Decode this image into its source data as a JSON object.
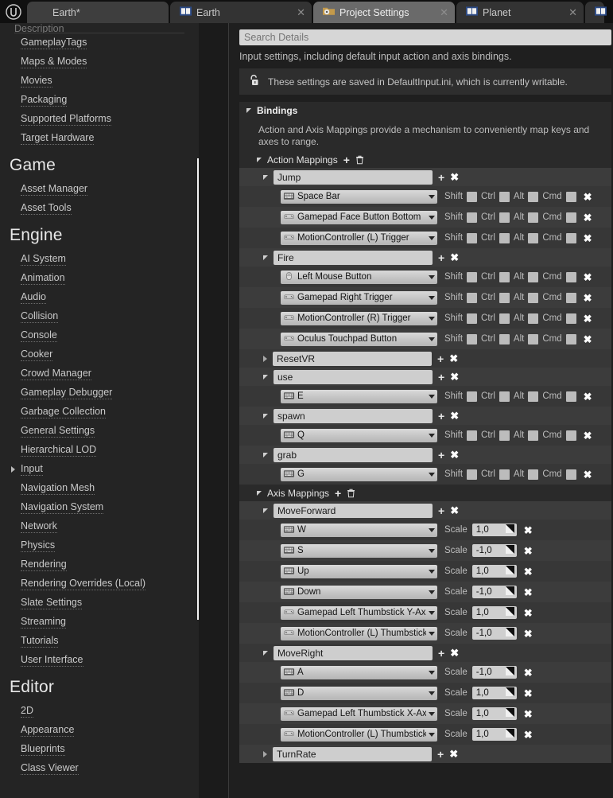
{
  "app": {
    "logo": "unreal-logo"
  },
  "tabs": [
    {
      "label": "Earth*",
      "icon": "",
      "closable": false,
      "state": "project"
    },
    {
      "label": "Earth",
      "icon": "level-icon",
      "closable": true,
      "state": "inactive"
    },
    {
      "label": "Project Settings",
      "icon": "settings-folder-icon",
      "closable": true,
      "state": "active"
    },
    {
      "label": "Planet",
      "icon": "level-icon",
      "closable": true,
      "state": "inactive"
    },
    {
      "label": "",
      "icon": "level-icon",
      "closable": false,
      "state": "inactive"
    }
  ],
  "sidebar": {
    "clipped_top_item": "Description",
    "groups": [
      {
        "heading": "",
        "items": [
          {
            "label": "GameplayTags",
            "expandable": false
          },
          {
            "label": "Maps & Modes",
            "expandable": false
          },
          {
            "label": "Movies",
            "expandable": false
          },
          {
            "label": "Packaging",
            "expandable": false
          },
          {
            "label": "Supported Platforms",
            "expandable": false
          },
          {
            "label": "Target Hardware",
            "expandable": false
          }
        ]
      },
      {
        "heading": "Game",
        "items": [
          {
            "label": "Asset Manager",
            "expandable": false
          },
          {
            "label": "Asset Tools",
            "expandable": false
          }
        ]
      },
      {
        "heading": "Engine",
        "items": [
          {
            "label": "AI System",
            "expandable": false
          },
          {
            "label": "Animation",
            "expandable": false
          },
          {
            "label": "Audio",
            "expandable": false
          },
          {
            "label": "Collision",
            "expandable": false
          },
          {
            "label": "Console",
            "expandable": false
          },
          {
            "label": "Cooker",
            "expandable": false
          },
          {
            "label": "Crowd Manager",
            "expandable": false
          },
          {
            "label": "Gameplay Debugger",
            "expandable": false
          },
          {
            "label": "Garbage Collection",
            "expandable": false
          },
          {
            "label": "General Settings",
            "expandable": false
          },
          {
            "label": "Hierarchical LOD",
            "expandable": false
          },
          {
            "label": "Input",
            "expandable": true
          },
          {
            "label": "Navigation Mesh",
            "expandable": false
          },
          {
            "label": "Navigation System",
            "expandable": false
          },
          {
            "label": "Network",
            "expandable": false
          },
          {
            "label": "Physics",
            "expandable": false
          },
          {
            "label": "Rendering",
            "expandable": false
          },
          {
            "label": "Rendering Overrides (Local)",
            "expandable": false
          },
          {
            "label": "Slate Settings",
            "expandable": false
          },
          {
            "label": "Streaming",
            "expandable": false
          },
          {
            "label": "Tutorials",
            "expandable": false
          },
          {
            "label": "User Interface",
            "expandable": false
          }
        ]
      },
      {
        "heading": "Editor",
        "items": [
          {
            "label": "2D",
            "expandable": false
          },
          {
            "label": "Appearance",
            "expandable": false
          },
          {
            "label": "Blueprints",
            "expandable": false
          },
          {
            "label": "Class Viewer",
            "expandable": false
          }
        ]
      }
    ]
  },
  "main": {
    "search_placeholder": "Search Details",
    "description": "Input settings, including default input action and axis bindings.",
    "notice": {
      "icon": "unlocked-padlock-icon",
      "text": "These settings are saved in DefaultInput.ini, which is currently writable."
    },
    "section": {
      "title": "Bindings",
      "expanded": true
    },
    "hint": "Action and Axis Mappings provide a mechanism to conveniently map keys and axes to range.",
    "action_group": {
      "label": "Action Mappings",
      "expanded": true,
      "add": "+",
      "delete": "trash-icon"
    },
    "axis_group": {
      "label": "Axis Mappings",
      "expanded": true,
      "add": "+",
      "delete": "trash-icon"
    },
    "mod_labels": {
      "shift": "Shift",
      "ctrl": "Ctrl",
      "alt": "Alt",
      "cmd": "Cmd"
    },
    "scale_label": "Scale"
  },
  "action_mappings": [
    {
      "name": "Jump",
      "expanded": true,
      "keys": [
        {
          "key": "Space Bar",
          "device": "keyboard-icon",
          "shift": false,
          "ctrl": false,
          "alt": false,
          "cmd": false
        },
        {
          "key": "Gamepad Face Button Bottom",
          "device": "gamepad-icon",
          "shift": false,
          "ctrl": false,
          "alt": false,
          "cmd": false
        },
        {
          "key": "MotionController (L) Trigger",
          "device": "gamepad-icon",
          "shift": false,
          "ctrl": false,
          "alt": false,
          "cmd": false
        }
      ]
    },
    {
      "name": "Fire",
      "expanded": true,
      "keys": [
        {
          "key": "Left Mouse Button",
          "device": "mouse-icon",
          "shift": false,
          "ctrl": false,
          "alt": false,
          "cmd": false
        },
        {
          "key": "Gamepad Right Trigger",
          "device": "gamepad-icon",
          "shift": false,
          "ctrl": false,
          "alt": false,
          "cmd": false
        },
        {
          "key": "MotionController (R) Trigger",
          "device": "gamepad-icon",
          "shift": false,
          "ctrl": false,
          "alt": false,
          "cmd": false
        },
        {
          "key": "Oculus Touchpad Button",
          "device": "gamepad-icon",
          "shift": false,
          "ctrl": false,
          "alt": false,
          "cmd": false
        }
      ]
    },
    {
      "name": "ResetVR",
      "expanded": false,
      "keys": []
    },
    {
      "name": "use",
      "expanded": true,
      "keys": [
        {
          "key": "E",
          "device": "keyboard-icon",
          "shift": false,
          "ctrl": false,
          "alt": false,
          "cmd": false
        }
      ]
    },
    {
      "name": "spawn",
      "expanded": true,
      "keys": [
        {
          "key": "Q",
          "device": "keyboard-icon",
          "shift": false,
          "ctrl": false,
          "alt": false,
          "cmd": false
        }
      ]
    },
    {
      "name": "grab",
      "expanded": true,
      "keys": [
        {
          "key": "G",
          "device": "keyboard-icon",
          "shift": false,
          "ctrl": false,
          "alt": false,
          "cmd": false
        }
      ]
    }
  ],
  "axis_mappings": [
    {
      "name": "MoveForward",
      "expanded": true,
      "keys": [
        {
          "key": "W",
          "device": "keyboard-icon",
          "scale": "1,0"
        },
        {
          "key": "S",
          "device": "keyboard-icon",
          "scale": "-1,0"
        },
        {
          "key": "Up",
          "device": "keyboard-icon",
          "scale": "1,0"
        },
        {
          "key": "Down",
          "device": "keyboard-icon",
          "scale": "-1,0"
        },
        {
          "key": "Gamepad Left Thumbstick Y-Axis",
          "device": "gamepad-icon",
          "scale": "1,0"
        },
        {
          "key": "MotionController (L) Thumbstick Y",
          "device": "gamepad-icon",
          "scale": "-1,0"
        }
      ]
    },
    {
      "name": "MoveRight",
      "expanded": true,
      "keys": [
        {
          "key": "A",
          "device": "keyboard-icon",
          "scale": "-1,0"
        },
        {
          "key": "D",
          "device": "keyboard-icon",
          "scale": "1,0"
        },
        {
          "key": "Gamepad Left Thumbstick X-Axis",
          "device": "gamepad-icon",
          "scale": "1,0"
        },
        {
          "key": "MotionController (L) Thumbstick X",
          "device": "gamepad-icon",
          "scale": "1,0"
        }
      ]
    },
    {
      "name": "TurnRate",
      "expanded": false,
      "keys": []
    }
  ],
  "colors": {
    "accent": "#f2f2f2",
    "panel": "#1f1f1f",
    "row": "#3c3c3c",
    "row_alt": "#373737",
    "field": "#cecece"
  }
}
